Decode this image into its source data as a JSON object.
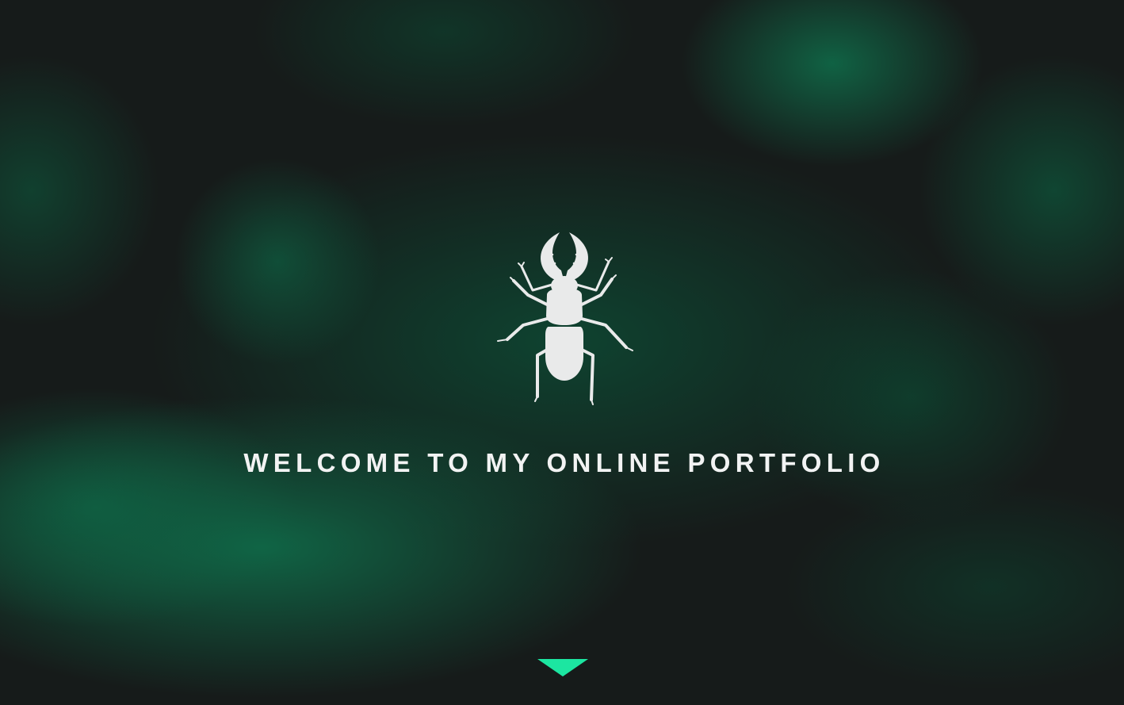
{
  "hero": {
    "headline": "WELCOME TO MY ONLINE PORTFOLIO",
    "logo_icon": "stag-beetle-icon",
    "scroll_icon": "triangle-down-icon"
  },
  "colors": {
    "background": "#161b1a",
    "glow": "#106646",
    "logo": "#e9eaea",
    "headline": "#f2f3f3",
    "accent": "#1ce6a1"
  }
}
